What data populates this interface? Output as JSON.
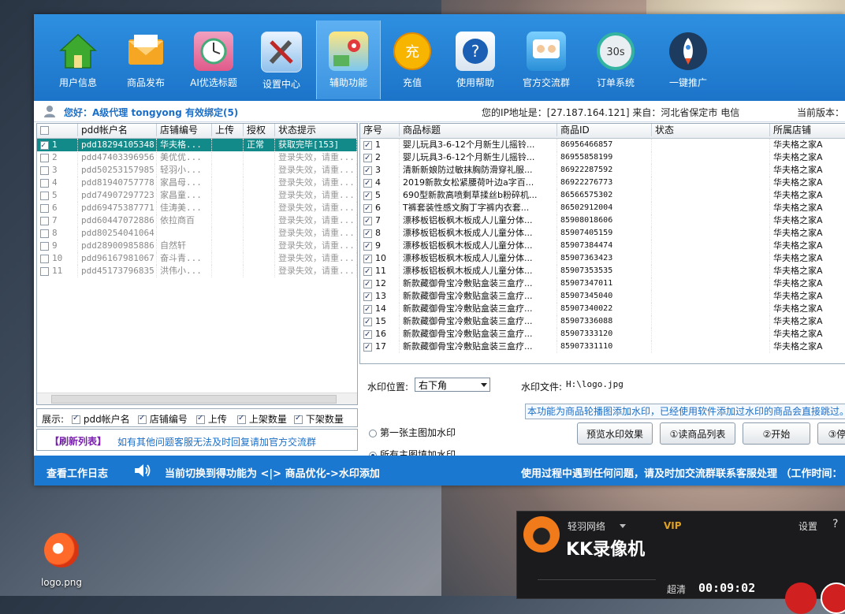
{
  "desktop": {
    "icon_label": "logo.png"
  },
  "toolbar": {
    "items": [
      {
        "label": "用户信息",
        "icon": "house-icon"
      },
      {
        "label": "商品发布",
        "icon": "envelope-icon"
      },
      {
        "label": "AI优选标题",
        "icon": "clock-icon"
      },
      {
        "label": "设置中心",
        "icon": "tools-icon"
      },
      {
        "label": "辅助功能",
        "icon": "map-pin-icon",
        "active": true
      },
      {
        "label": "充值",
        "icon": "coin-icon"
      },
      {
        "label": "使用帮助",
        "icon": "help-icon"
      },
      {
        "label": "官方交流群",
        "icon": "chat-icon"
      },
      {
        "label": "订单系统",
        "icon": "timer-icon"
      },
      {
        "label": "一键推广",
        "icon": "rocket-icon"
      }
    ],
    "timer_text": "30s"
  },
  "infobar": {
    "greeting": "您好：A级代理 tongyong  有效绑定(5)",
    "ip": "您的IP地址是：[27.187.164.121] 来自：河北省保定市 电信",
    "version": "当前版本："
  },
  "accounts": {
    "headers": [
      "pdd帐户名",
      "店铺编号",
      "上传",
      "授权",
      "状态提示"
    ],
    "rows": [
      {
        "no": "1",
        "acct": "pdd18294105348",
        "shop": "华夫格...",
        "upload": "",
        "auth": "正常",
        "status": "获取完毕[153]",
        "checked": true,
        "selected": true
      },
      {
        "no": "2",
        "acct": "pdd47403396956",
        "shop": "美优优...",
        "upload": "",
        "auth": "",
        "status": "登录失效，请重...",
        "checked": false
      },
      {
        "no": "3",
        "acct": "pdd50253157985",
        "shop": "轻羽小...",
        "upload": "",
        "auth": "",
        "status": "登录失效，请重...",
        "checked": false
      },
      {
        "no": "4",
        "acct": "pdd81940757778",
        "shop": "家昌母...",
        "upload": "",
        "auth": "",
        "status": "登录失效，请重...",
        "checked": false
      },
      {
        "no": "5",
        "acct": "pdd74907297723",
        "shop": "家昌童...",
        "upload": "",
        "auth": "",
        "status": "登录失效，请重...",
        "checked": false
      },
      {
        "no": "6",
        "acct": "pdd69475387771",
        "shop": "佳涛美...",
        "upload": "",
        "auth": "",
        "status": "登录失效，请重...",
        "checked": false
      },
      {
        "no": "7",
        "acct": "pdd60447072886",
        "shop": "依拉商百",
        "upload": "",
        "auth": "",
        "status": "登录失效，请重...",
        "checked": false
      },
      {
        "no": "8",
        "acct": "pdd80254041064",
        "shop": "",
        "upload": "",
        "auth": "",
        "status": "登录失效，请重...",
        "checked": false
      },
      {
        "no": "9",
        "acct": "pdd28900985886",
        "shop": "自然轩",
        "upload": "",
        "auth": "",
        "status": "登录失效，请重...",
        "checked": false
      },
      {
        "no": "10",
        "acct": "pdd96167981067",
        "shop": "奋斗青...",
        "upload": "",
        "auth": "",
        "status": "登录失效，请重...",
        "checked": false
      },
      {
        "no": "11",
        "acct": "pdd45173796835",
        "shop": "洪伟小...",
        "upload": "",
        "auth": "",
        "status": "登录失效，请重...",
        "checked": false
      }
    ]
  },
  "show_options": {
    "label": "展示:",
    "options": [
      "pdd帐户名",
      "店铺编号",
      "上传",
      "上架数量",
      "下架数量"
    ]
  },
  "notice": {
    "refresh": "【刷新列表】",
    "message": "如有其他问题客服无法及时回复请加官方交流群"
  },
  "products": {
    "headers": [
      "序号",
      "商品标题",
      "商品ID",
      "状态",
      "所属店铺"
    ],
    "rows": [
      {
        "no": "1",
        "title": "婴儿玩具3-6-12个月新生儿摇铃...",
        "id": "86956466857",
        "status": "",
        "shop": "华夫格之家A"
      },
      {
        "no": "2",
        "title": "婴儿玩具3-6-12个月新生儿摇铃...",
        "id": "86955858199",
        "status": "",
        "shop": "华夫格之家A"
      },
      {
        "no": "3",
        "title": "清新新娘防过敏抹胸防滑穿礼服...",
        "id": "86922287592",
        "status": "",
        "shop": "华夫格之家A"
      },
      {
        "no": "4",
        "title": "2019新款女松紧腰荷叶边a字百...",
        "id": "86922276773",
        "status": "",
        "shop": "华夫格之家A"
      },
      {
        "no": "5",
        "title": "690型新款高喷剩草揉丝b粉碎机...",
        "id": "86566575302",
        "status": "",
        "shop": "华夫格之家A"
      },
      {
        "no": "6",
        "title": "T裤套装性感文胸丁字裤内衣套...",
        "id": "86502912004",
        "status": "",
        "shop": "华夫格之家A"
      },
      {
        "no": "7",
        "title": "漂移板铝板枫木板成人儿童分体...",
        "id": "85908018606",
        "status": "",
        "shop": "华夫格之家A"
      },
      {
        "no": "8",
        "title": "漂移板铝板枫木板成人儿童分体...",
        "id": "85907405159",
        "status": "",
        "shop": "华夫格之家A"
      },
      {
        "no": "9",
        "title": "漂移板铝板枫木板成人儿童分体...",
        "id": "85907384474",
        "status": "",
        "shop": "华夫格之家A"
      },
      {
        "no": "10",
        "title": "漂移板铝板枫木板成人儿童分体...",
        "id": "85907363423",
        "status": "",
        "shop": "华夫格之家A"
      },
      {
        "no": "11",
        "title": "漂移板铝板枫木板成人儿童分体...",
        "id": "85907353535",
        "status": "",
        "shop": "华夫格之家A"
      },
      {
        "no": "12",
        "title": "新款藏御骨宝冷敷贴盒装三盒疗...",
        "id": "85907347011",
        "status": "",
        "shop": "华夫格之家A"
      },
      {
        "no": "13",
        "title": "新款藏御骨宝冷敷贴盒装三盒疗...",
        "id": "85907345040",
        "status": "",
        "shop": "华夫格之家A"
      },
      {
        "no": "14",
        "title": "新款藏御骨宝冷敷贴盒装三盒疗...",
        "id": "85907340022",
        "status": "",
        "shop": "华夫格之家A"
      },
      {
        "no": "15",
        "title": "新款藏御骨宝冷敷贴盒装三盒疗...",
        "id": "85907336088",
        "status": "",
        "shop": "华夫格之家A"
      },
      {
        "no": "16",
        "title": "新款藏御骨宝冷敷贴盒装三盒疗...",
        "id": "85907333120",
        "status": "",
        "shop": "华夫格之家A"
      },
      {
        "no": "17",
        "title": "新款藏御骨宝冷敷贴盒装三盒疗...",
        "id": "85907331110",
        "status": "",
        "shop": "华夫格之家A"
      }
    ]
  },
  "watermark": {
    "pos_label": "水印位置:",
    "pos_value": "右下角",
    "file_label": "水印文件:",
    "file_value": "H:\\logo.jpg",
    "opt1": "第一张主图加水印",
    "opt2": "所有主图填加水印",
    "tip": "本功能为商品轮播图添加水印，已经使用软件添加过水印的商品会直接跳过。",
    "btn_preview": "预览水印效果",
    "btn_read": "①读商品列表",
    "btn_start": "②开始",
    "btn_stop": "③停"
  },
  "statusbar": {
    "log": "查看工作日志",
    "mode": "当前切换到得功能为 <|> 商品优化->水印添加",
    "help": "使用过程中遇到任何问题，请及时加交流群联系客服处理 （工作时间："
  },
  "kk": {
    "user": "轻羽网络",
    "vip": "VIP",
    "settings": "设置",
    "help": "?",
    "title": "KK录像机",
    "quality": "超清",
    "time": "00:09:02"
  },
  "colors": {
    "toolbar": "#1c74c9",
    "status_bar": "#1b78d0",
    "selected_row": "#128a8a"
  }
}
